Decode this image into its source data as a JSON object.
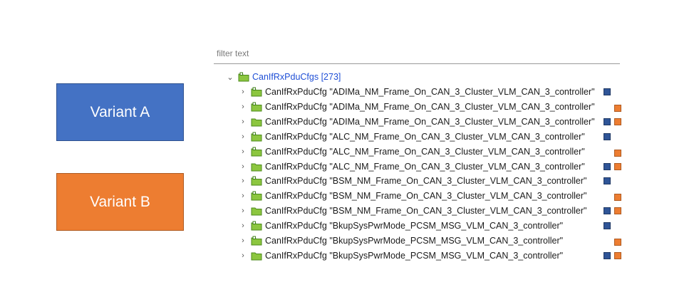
{
  "variants": {
    "a": {
      "label": "Variant A",
      "color": "#4472C4"
    },
    "b": {
      "label": "Variant B",
      "color": "#ED7D31"
    }
  },
  "tree": {
    "filter_placeholder": "filter text",
    "root": {
      "label": "CanIfRxPduCfgs [273]",
      "expanded": true
    },
    "rows": [
      {
        "type": "CanIfRxPduCfg",
        "name": "\"ADIMa_NM_Frame_On_CAN_3_Cluster_VLM_CAN_3_controller\"",
        "markers": [
          "blue"
        ],
        "icon": "folder-variant"
      },
      {
        "type": "CanIfRxPduCfg",
        "name": "\"ADIMa_NM_Frame_On_CAN_3_Cluster_VLM_CAN_3_controller\"",
        "markers": [
          "orange"
        ],
        "icon": "folder-variant"
      },
      {
        "type": "CanIfRxPduCfg",
        "name": "\"ADIMa_NM_Frame_On_CAN_3_Cluster_VLM_CAN_3_controller\"",
        "markers": [
          "blue",
          "orange"
        ],
        "icon": "folder"
      },
      {
        "type": "CanIfRxPduCfg",
        "name": "\"ALC_NM_Frame_On_CAN_3_Cluster_VLM_CAN_3_controller\"",
        "markers": [
          "blue"
        ],
        "icon": "folder-variant"
      },
      {
        "type": "CanIfRxPduCfg",
        "name": "\"ALC_NM_Frame_On_CAN_3_Cluster_VLM_CAN_3_controller\"",
        "markers": [
          "orange"
        ],
        "icon": "folder-variant"
      },
      {
        "type": "CanIfRxPduCfg",
        "name": "\"ALC_NM_Frame_On_CAN_3_Cluster_VLM_CAN_3_controller\"",
        "markers": [
          "blue",
          "orange"
        ],
        "icon": "folder"
      },
      {
        "type": "CanIfRxPduCfg",
        "name": "\"BSM_NM_Frame_On_CAN_3_Cluster_VLM_CAN_3_controller\"",
        "markers": [
          "blue"
        ],
        "icon": "folder-variant"
      },
      {
        "type": "CanIfRxPduCfg",
        "name": "\"BSM_NM_Frame_On_CAN_3_Cluster_VLM_CAN_3_controller\"",
        "markers": [
          "orange"
        ],
        "icon": "folder-variant"
      },
      {
        "type": "CanIfRxPduCfg",
        "name": "\"BSM_NM_Frame_On_CAN_3_Cluster_VLM_CAN_3_controller\"",
        "markers": [
          "blue",
          "orange"
        ],
        "icon": "folder"
      },
      {
        "type": "CanIfRxPduCfg",
        "name": "\"BkupSysPwrMode_PCSM_MSG_VLM_CAN_3_controller\"",
        "markers": [
          "blue"
        ],
        "icon": "folder-variant"
      },
      {
        "type": "CanIfRxPduCfg",
        "name": "\"BkupSysPwrMode_PCSM_MSG_VLM_CAN_3_controller\"",
        "markers": [
          "orange"
        ],
        "icon": "folder-variant"
      },
      {
        "type": "CanIfRxPduCfg",
        "name": "\"BkupSysPwrMode_PCSM_MSG_VLM_CAN_3_controller\"",
        "markers": [
          "blue",
          "orange"
        ],
        "icon": "folder"
      }
    ]
  }
}
